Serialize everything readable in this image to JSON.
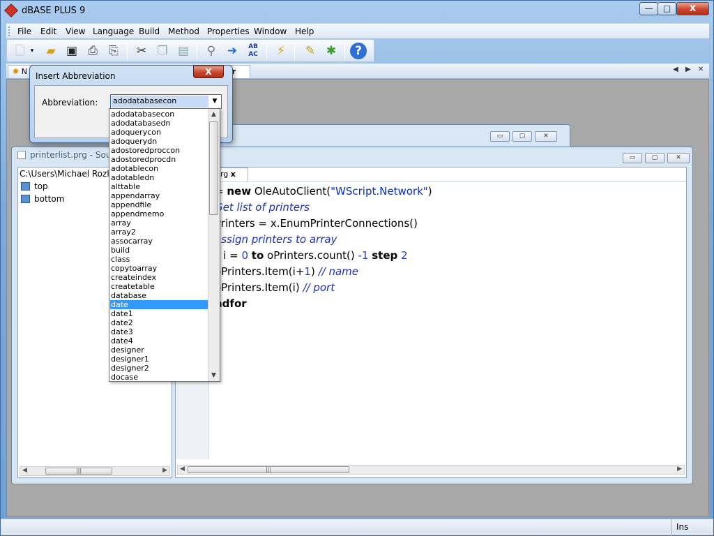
{
  "app": {
    "title": "dBASE PLUS 9"
  },
  "window_controls": {
    "minimize": "—",
    "maximize": "□",
    "close": "X"
  },
  "menu": [
    "File",
    "Edit",
    "View",
    "Language",
    "Build",
    "Method",
    "Properties",
    "Window",
    "Help"
  ],
  "toolbar": {
    "icons": [
      "new-file-icon",
      "open-folder-icon",
      "save-icon",
      "print-icon",
      "print-preview-icon",
      "cut-icon",
      "copy-icon",
      "paste-icon",
      "find-icon",
      "find-next-icon",
      "replace-icon",
      "run-icon",
      "design-icon",
      "debug-icon",
      "help-icon"
    ],
    "replace_glyph": "AB AC",
    "help_glyph": "?"
  },
  "tabs": {
    "first": "N",
    "active": "itor"
  },
  "source_window": {
    "title": "printerlist.prg - Sourc",
    "path": "C:\\Users\\Michael Rozlog",
    "tree": [
      "top",
      "bottom"
    ]
  },
  "editor": {
    "file_tab": "prg",
    "close": "x",
    "lines": [
      [
        {
          "t": "= ",
          "c": "p"
        },
        {
          "t": "new",
          "c": "kw"
        },
        {
          "t": " OleAutoClient(",
          "c": "p"
        },
        {
          "t": "\"WScript.Network\"",
          "c": "str"
        },
        {
          "t": ")",
          "c": "p"
        }
      ],
      [
        {
          "t": "Get list of printers",
          "c": "com"
        }
      ],
      [
        {
          "t": "Printers = x.EnumPrinterConnections()",
          "c": "p"
        }
      ],
      [
        {
          "t": "assign printers to array",
          "c": "com"
        }
      ],
      [
        {
          "t": "r",
          "c": "kw"
        },
        {
          "t": " i = ",
          "c": "p"
        },
        {
          "t": "0",
          "c": "num"
        },
        {
          "t": " ",
          "c": "p"
        },
        {
          "t": "to",
          "c": "kw"
        },
        {
          "t": " oPrinters.count() ",
          "c": "p"
        },
        {
          "t": "-1",
          "c": "num"
        },
        {
          "t": " ",
          "c": "p"
        },
        {
          "t": "step",
          "c": "kw"
        },
        {
          "t": " ",
          "c": "p"
        },
        {
          "t": "2",
          "c": "num"
        }
      ],
      [
        {
          "t": "oPrinters.Item(i+",
          "c": "p"
        },
        {
          "t": "1",
          "c": "num"
        },
        {
          "t": ") ",
          "c": "p"
        },
        {
          "t": "// name",
          "c": "com"
        }
      ],
      [
        {
          "t": "oPrinters.Item(i) ",
          "c": "p"
        },
        {
          "t": "// port",
          "c": "com"
        }
      ],
      [
        {
          "t": "ndfor",
          "c": "kw"
        }
      ]
    ]
  },
  "dialog": {
    "title": "Insert Abbreviation",
    "close": "X",
    "label": "Abbreviation:",
    "selected_value": "adodatabasecon",
    "options": [
      "adodatabasecon",
      "adodatabasedn",
      "adoquerycon",
      "adoquerydn",
      "adostoredproccon",
      "adostoredprocdn",
      "adotablecon",
      "adotabledn",
      "alttable",
      "appendarray",
      "appendfile",
      "appendmemo",
      "array",
      "array2",
      "assocarray",
      "build",
      "class",
      "copytoarray",
      "createindex",
      "createtable",
      "database",
      "date",
      "date1",
      "date2",
      "date3",
      "date4",
      "designer",
      "designer1",
      "designer2",
      "docase"
    ],
    "highlighted": "date"
  },
  "status": {
    "mode": "Ins"
  },
  "colors": {
    "selection": "#3399ff",
    "string": "#0a2fb8",
    "comment": "#1d2fb1",
    "titlebar": "#a9cbee"
  }
}
